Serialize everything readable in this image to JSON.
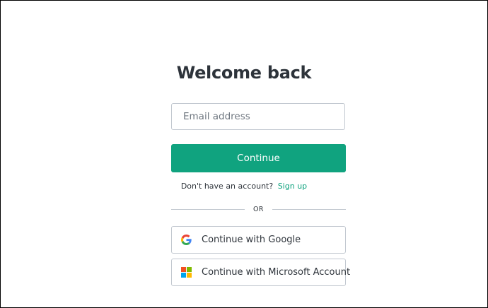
{
  "login": {
    "title": "Welcome back",
    "email_placeholder": "Email address",
    "email_value": "",
    "continue_label": "Continue",
    "signup_prompt": "Don't have an account?",
    "signup_link": "Sign up",
    "divider_text": "OR",
    "google_label": "Continue with Google",
    "microsoft_label": "Continue with Microsoft Account",
    "icons": {
      "google": "google-logo-icon",
      "microsoft": "microsoft-logo-icon"
    }
  },
  "colors": {
    "accent": "#10a37f",
    "text": "#2d333a",
    "border": "#c2c8d0",
    "microsoft_red": "#f25022",
    "microsoft_green": "#7fba00",
    "microsoft_blue": "#00a4ef",
    "microsoft_yellow": "#ffb900"
  }
}
